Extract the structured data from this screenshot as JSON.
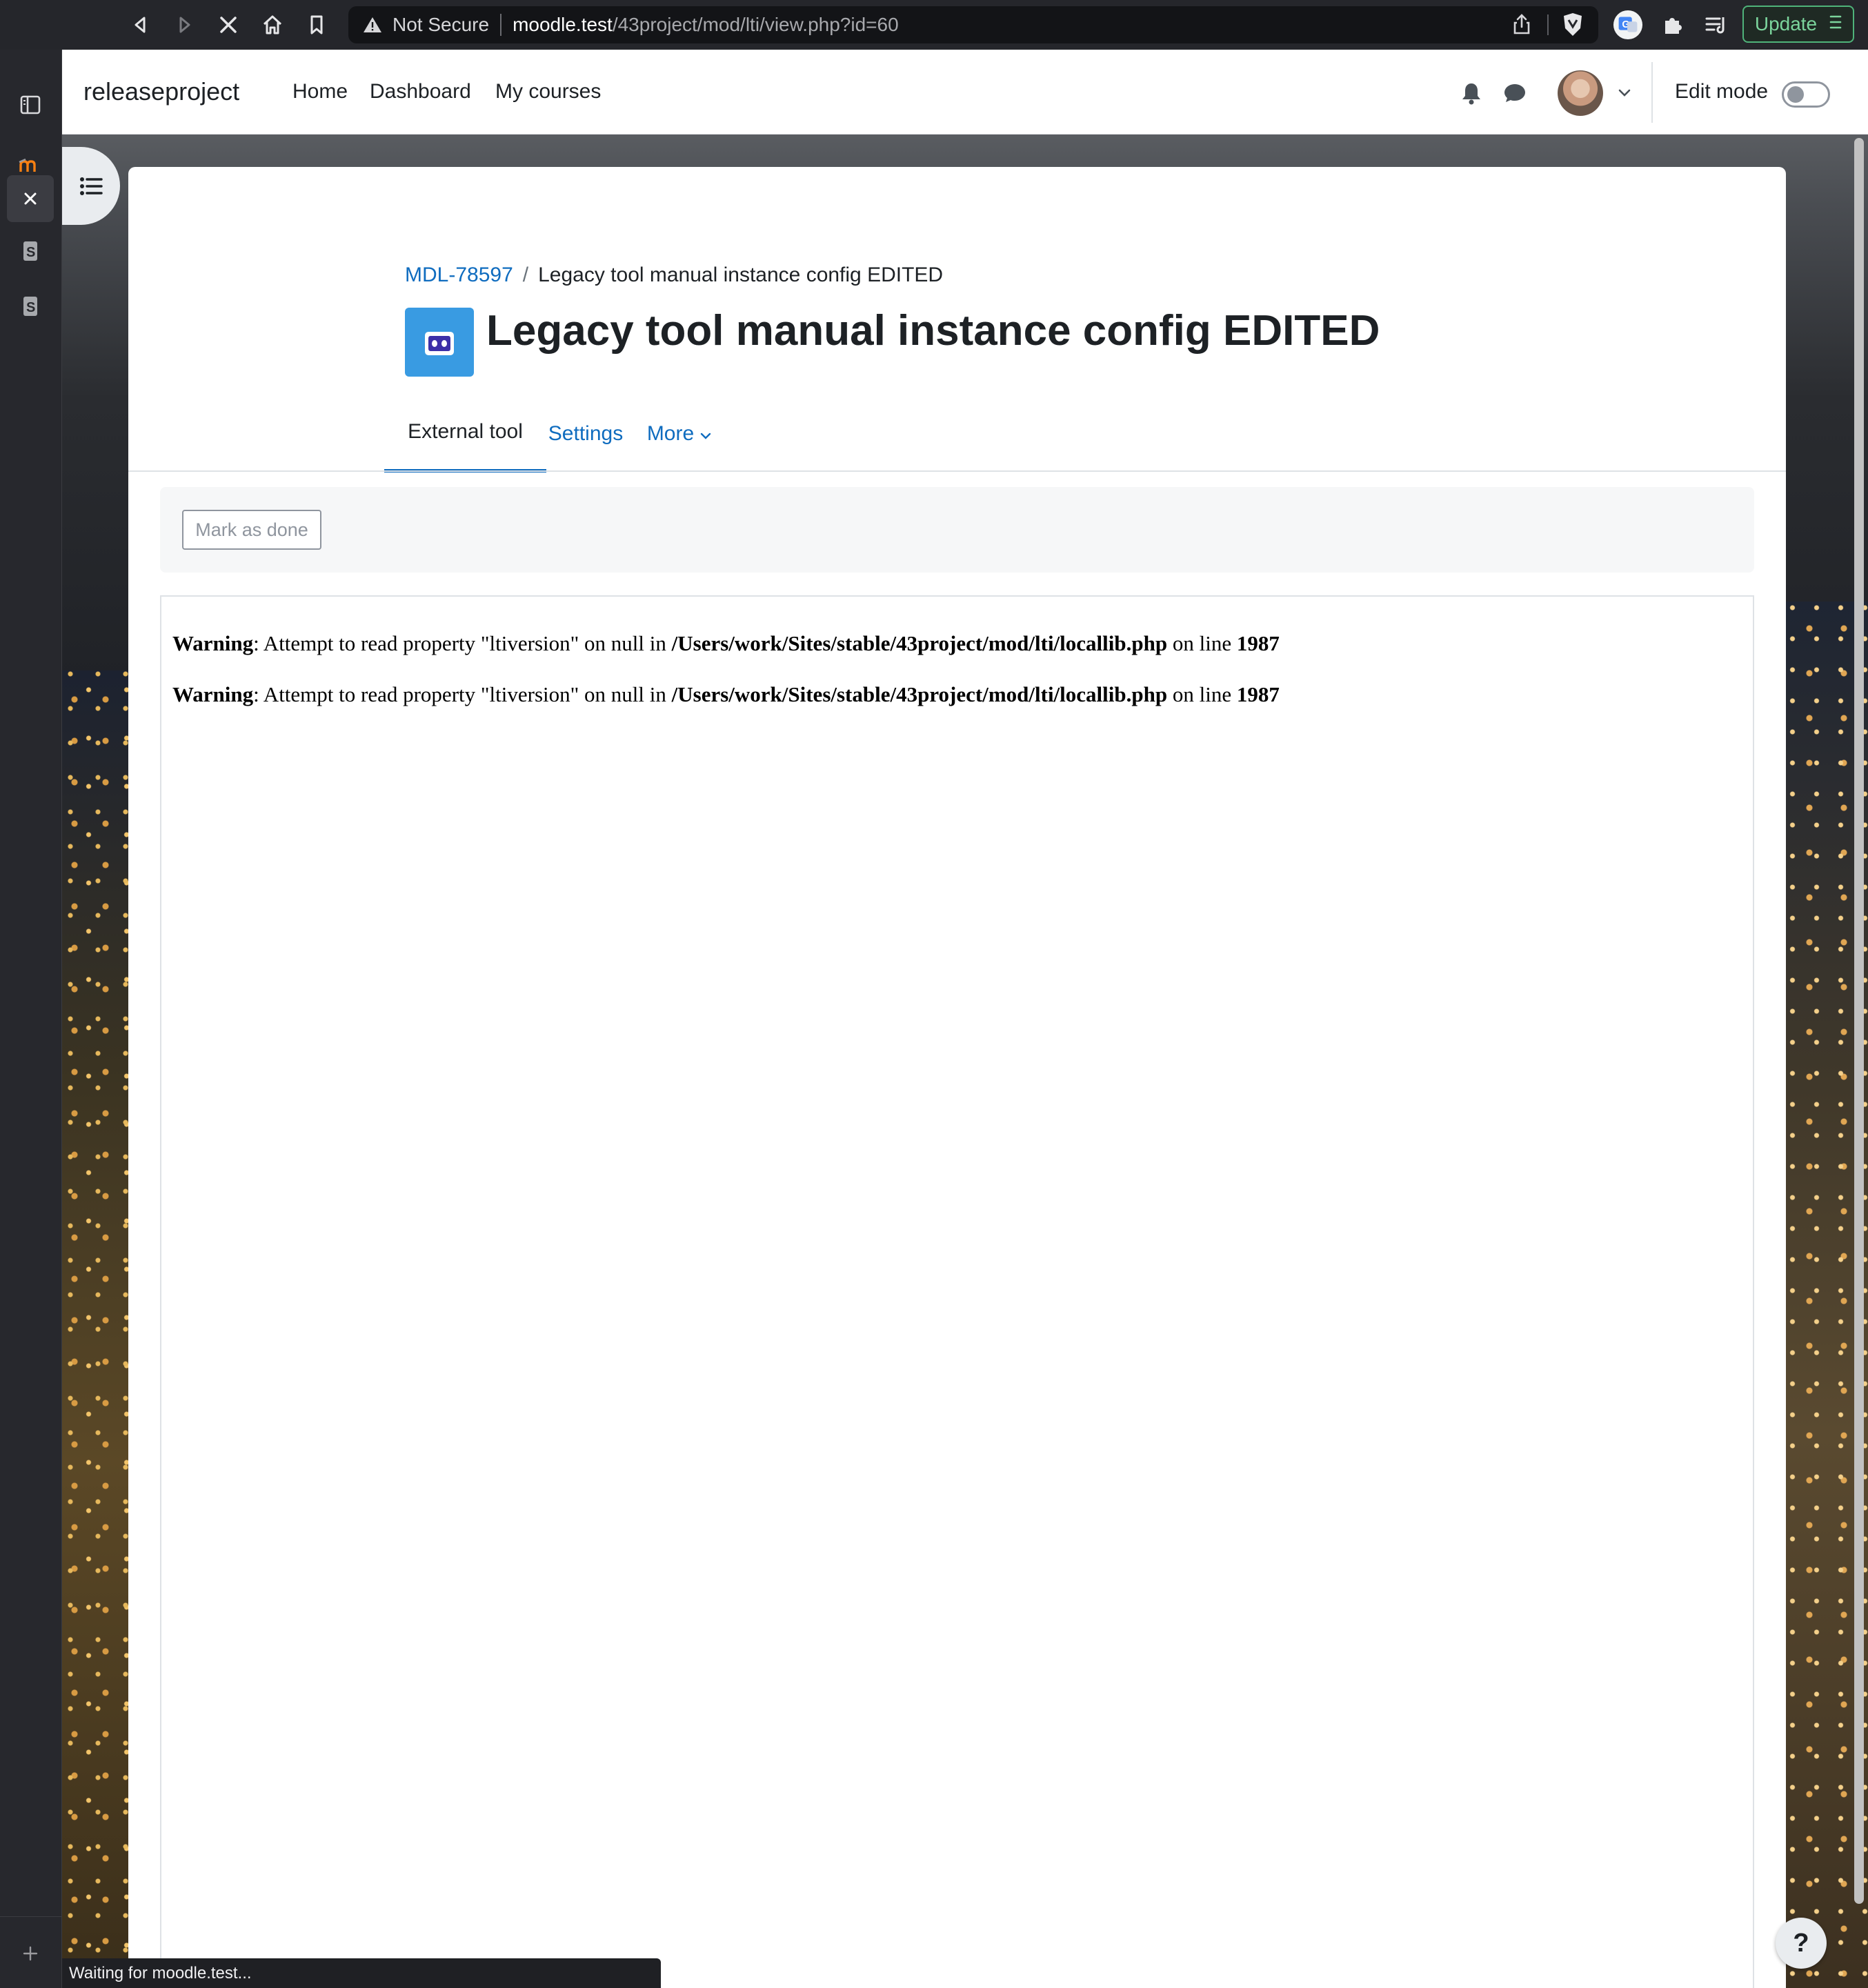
{
  "browser": {
    "security_label": "Not Secure",
    "url_host": "moodle.test",
    "url_path": "/43project/mod/lti/view.php?id=60",
    "update_label": "Update",
    "status_text": "Waiting for moodle.test...",
    "accent_colors": {
      "update": "#4fb37a",
      "chrome_bg": "#25262b"
    }
  },
  "sidebar": {
    "items": [
      {
        "icon": "panel-icon"
      },
      {
        "icon": "moodle-logo-icon"
      },
      {
        "icon": "close-icon"
      },
      {
        "icon": "app-s-icon"
      },
      {
        "icon": "app-s-icon"
      }
    ],
    "add_icon": "plus-icon"
  },
  "site": {
    "brand": "releaseproject",
    "nav": [
      "Home",
      "Dashboard",
      "My courses"
    ],
    "edit_mode_label": "Edit mode",
    "edit_mode_on": false,
    "link_color": "#0f6cbf"
  },
  "page": {
    "breadcrumb": {
      "course": "MDL-78597",
      "separator": "/",
      "current": "Legacy tool manual instance config EDITED"
    },
    "title": "Legacy tool manual instance config EDITED",
    "tabs": {
      "external_tool": "External tool",
      "settings": "Settings",
      "more": "More"
    },
    "mark_done_label": "Mark as done",
    "warnings": [
      {
        "label": "Warning",
        "message": ": Attempt to read property \"ltiversion\" on null in ",
        "file": "/Users/work/Sites/stable/43project/mod/lti/locallib.php",
        "on_line": " on line ",
        "line": "1987"
      },
      {
        "label": "Warning",
        "message": ": Attempt to read property \"ltiversion\" on null in ",
        "file": "/Users/work/Sites/stable/43project/mod/lti/locallib.php",
        "on_line": " on line ",
        "line": "1987"
      }
    ],
    "help_label": "?"
  }
}
